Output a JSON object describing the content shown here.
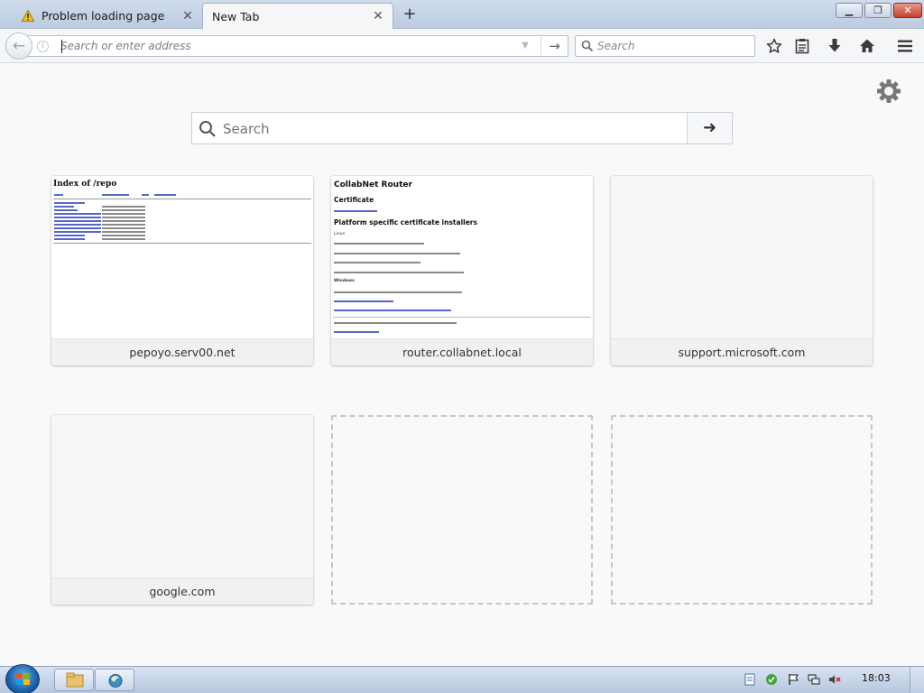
{
  "tabs": [
    {
      "label": "Problem loading page",
      "icon": "warning-icon",
      "active": false
    },
    {
      "label": "New Tab",
      "active": true
    }
  ],
  "navbar": {
    "url_placeholder": "Search or enter address",
    "search_placeholder": "Search"
  },
  "content": {
    "search_placeholder": "Search",
    "tiles": [
      {
        "title": "pepoyo.serv00.net"
      },
      {
        "title": "router.collabnet.local"
      },
      {
        "title": "support.microsoft.com"
      },
      {
        "title": "google.com"
      },
      {
        "title": ""
      },
      {
        "title": ""
      }
    ],
    "thumb_pepoyo": {
      "heading": "Index of /repo"
    },
    "thumb_router": {
      "heading": "CollabNet Router",
      "certificate": "Certificate",
      "platform": "Platform specific certificate installers",
      "linux": "Linux",
      "windows": "Windows"
    }
  },
  "taskbar": {
    "clock": "18:03"
  },
  "colors": {
    "tab_strip": "#c5d4e8",
    "content_bg": "#f9f9fa",
    "tile_title_bg": "#f0f1f2"
  }
}
